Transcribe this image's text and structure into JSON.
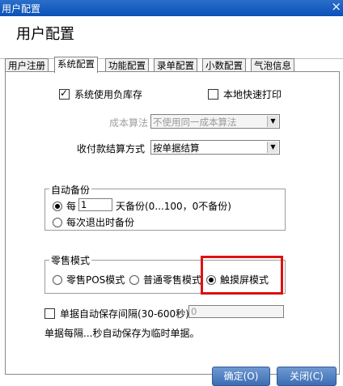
{
  "window": {
    "title": "用户配置",
    "close_glyph": "×"
  },
  "header": {
    "title": "用户配置"
  },
  "tabs": [
    "用户注册",
    "系统配置",
    "功能配置",
    "录单配置",
    "小数配置",
    "气泡信息"
  ],
  "system": {
    "use_inventory_label": "系统使用负库存",
    "local_print_label": "本地快速打印",
    "cost_method_label": "成本算法",
    "cost_method_value": "不使用同一成本算法",
    "payment_method_label": "收付款结算方式",
    "payment_method_value": "按单据结算"
  },
  "auto_backup": {
    "legend": "自动备份",
    "every_label": "每",
    "days_value": "1",
    "days_suffix": "天备份(0...100，0不备份)",
    "on_exit_label": "每次退出时备份"
  },
  "retail_mode": {
    "legend": "零售模式",
    "option_pos": "零售POS模式",
    "option_normal": "普通零售模式",
    "option_touch": "触摸屏模式"
  },
  "auto_save": {
    "label": "单据自动保存间隔(30-600秒)",
    "value": "0",
    "note": "单据每隔...秒自动保存为临时单据。"
  },
  "buttons": {
    "ok": "确定(O)",
    "close": "关闭(C)"
  }
}
